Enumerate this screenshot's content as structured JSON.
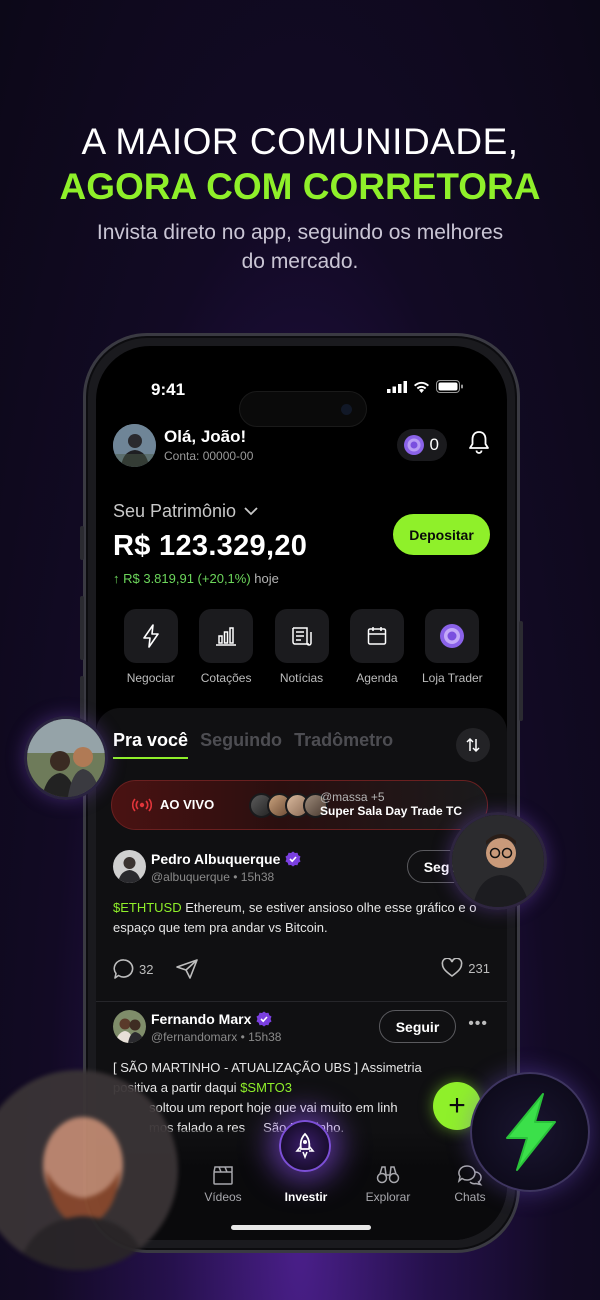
{
  "headline": {
    "line1": "A MAIOR COMUNIDADE,",
    "line2": "AGORA COM CORRETORA",
    "sub_line1": "Invista direto no app, seguindo os melhores",
    "sub_line2": "do mercado."
  },
  "status_bar": {
    "time": "9:41"
  },
  "header": {
    "greeting": "Olá, João!",
    "account": "Conta: 00000-00",
    "coins": "0"
  },
  "portfolio": {
    "label": "Seu Patrimônio",
    "value": "R$ 123.329,20",
    "gain": "↑ R$ 3.819,91 (+20,1%)",
    "gain_period": "hoje",
    "deposit_label": "Depositar"
  },
  "quick_actions": [
    {
      "label": "Negociar",
      "icon": "lightning-icon"
    },
    {
      "label": "Cotações",
      "icon": "bar-chart-icon"
    },
    {
      "label": "Notícias",
      "icon": "news-icon"
    },
    {
      "label": "Agenda",
      "icon": "calendar-icon"
    },
    {
      "label": "Loja Trader",
      "icon": "coin-icon"
    }
  ],
  "feed_tabs": [
    "Pra você",
    "Seguindo",
    "Tradômetro"
  ],
  "live": {
    "tag": "AO VIVO",
    "users": "@massa +5",
    "title": "Super Sala Day Trade TC"
  },
  "posts": [
    {
      "name": "Pedro Albuquerque",
      "handle": "@albuquerque",
      "time": "15h38",
      "follow": "Seguir",
      "ticker": "$ETHTUSD",
      "text": " Ethereum, se estiver ansioso olhe esse gráfico e o espaço que tem pra andar vs Bitcoin.",
      "comments": "32",
      "likes": "231"
    },
    {
      "name": "Fernando Marx",
      "handle": "@fernandomarx",
      "time": "15h38",
      "follow": "Seguir",
      "text_line1": "[ SÃO MARTINHO - ATUALIZAÇÃO UBS ] Assimetria",
      "text_line2_pre": "positiva a partir daqui ",
      "ticker": "$SMTO3",
      "text_line3": "soltou um report hoje que vai muito em linh",
      "text_line4": "mos falado a res     São Martinho."
    }
  ],
  "bottom_nav": [
    {
      "label": "Vídeos",
      "icon": "clapperboard-icon"
    },
    {
      "label": "Investir",
      "icon": "rocket-icon"
    },
    {
      "label": "Explorar",
      "icon": "binoculars-icon"
    },
    {
      "label": "Chats",
      "icon": "chat-bubbles-icon"
    }
  ],
  "colors": {
    "accent": "#8ff02a",
    "live": "#e0353a",
    "verified": "#7a3fe0",
    "background": "#120a24"
  }
}
